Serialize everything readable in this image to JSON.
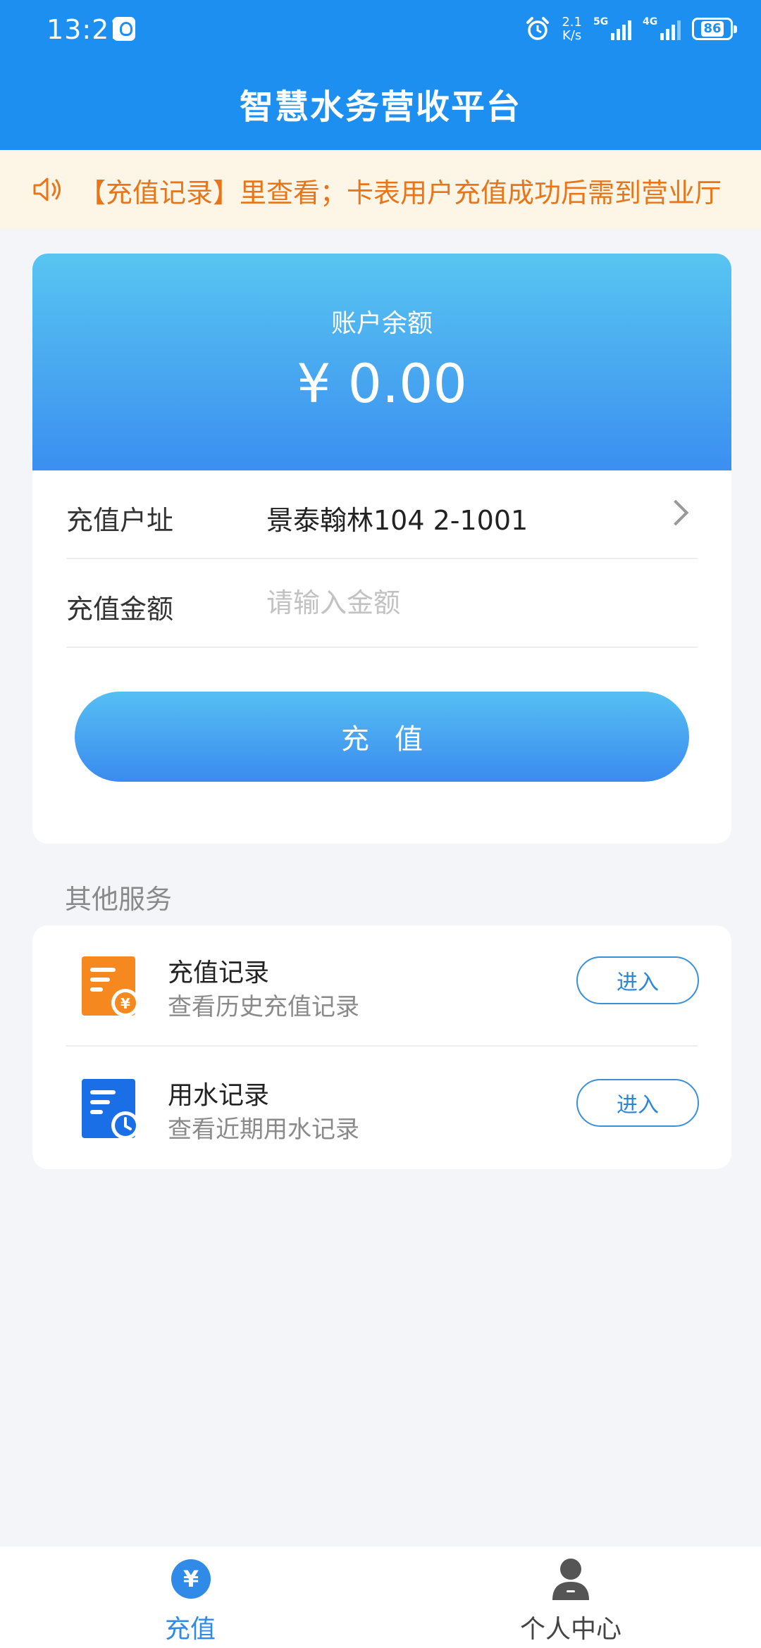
{
  "status_bar": {
    "time": "13:21",
    "speed_value": "2.1",
    "speed_unit": "K/s",
    "signal1_tag": "5G",
    "signal2_tag": "4G",
    "battery": "86"
  },
  "header": {
    "title": "智慧水务营收平台"
  },
  "notice": {
    "text": "【充值记录】里查看；卡表用户充值成功后需到营业厅"
  },
  "balance": {
    "label": "账户余额",
    "amount": "¥ 0.00"
  },
  "form": {
    "address_label": "充值户址",
    "address_value": "景泰翰林104  2-1001",
    "amount_label": "充值金额",
    "amount_placeholder": "请输入金额",
    "amount_value": "",
    "submit_label": "充值"
  },
  "services": {
    "section_title": "其他服务",
    "items": [
      {
        "title": "充值记录",
        "subtitle": "查看历史充值记录",
        "button": "进入",
        "icon": "recharge-record-icon",
        "color": "#f5891f"
      },
      {
        "title": "用水记录",
        "subtitle": "查看近期用水记录",
        "button": "进入",
        "icon": "water-record-icon",
        "color": "#1a6fe6"
      }
    ]
  },
  "bottom_nav": {
    "items": [
      {
        "label": "充值",
        "icon": "yuan-icon",
        "icon_glyph": "¥",
        "active": true
      },
      {
        "label": "个人中心",
        "icon": "user-icon",
        "active": false
      }
    ]
  },
  "colors": {
    "primary": "#1d8ff0",
    "notice_text": "#e8751a",
    "notice_bg": "#fdf6e6"
  }
}
